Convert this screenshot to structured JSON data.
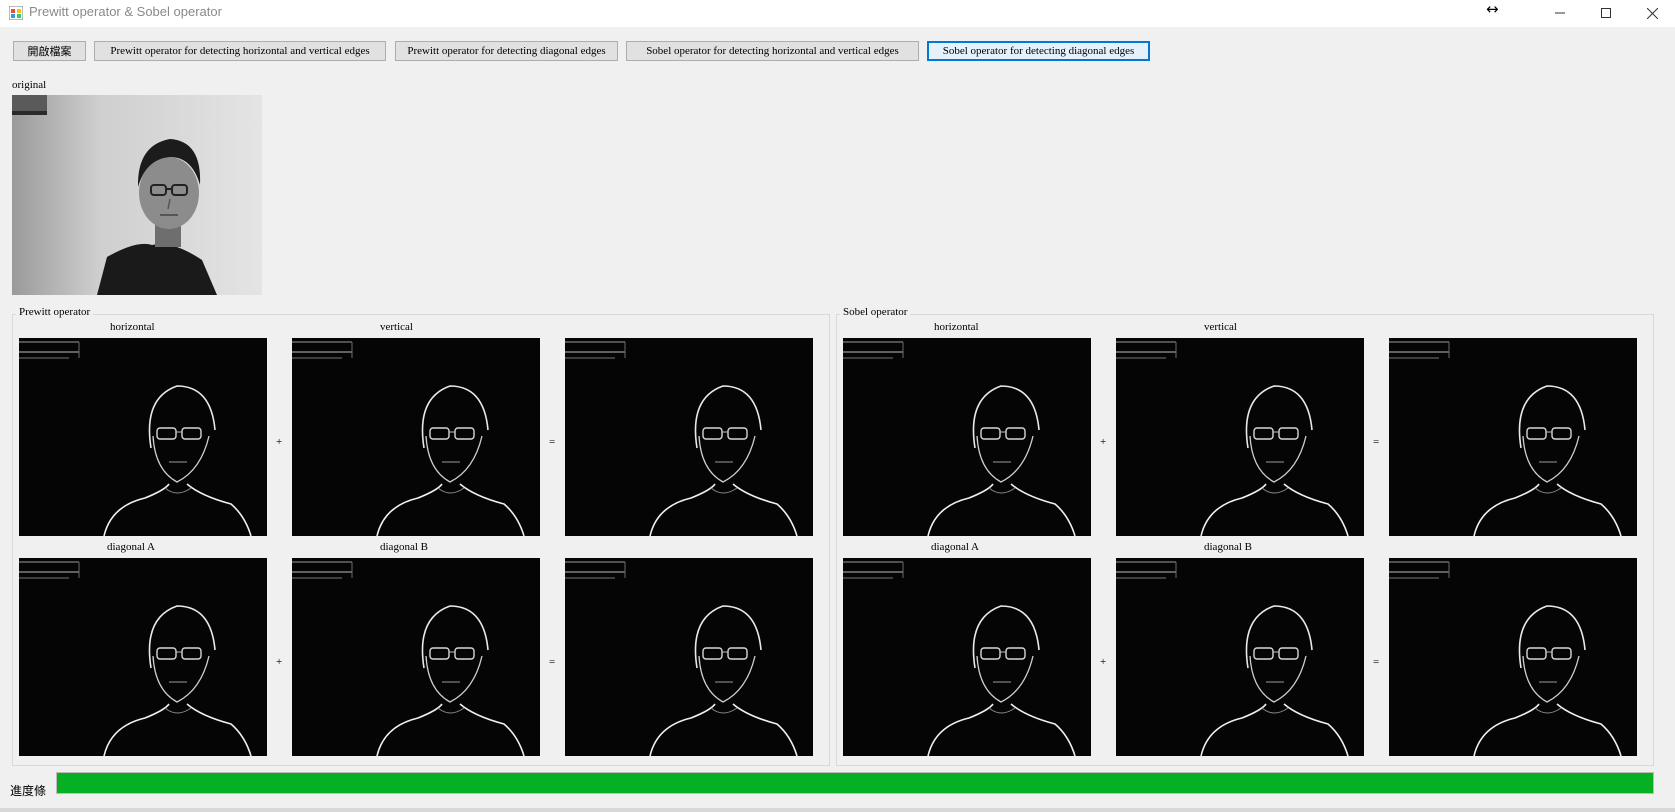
{
  "window": {
    "title": "Prewitt operator & Sobel operator"
  },
  "toolbar": {
    "open_file": "開啟檔案",
    "prewitt_hv": "Prewitt operator for detecting horizontal and vertical edges",
    "prewitt_diag": "Prewitt operator for detecting diagonal edges",
    "sobel_hv": "Sobel operator for detecting horizontal and vertical edges",
    "sobel_diag": "Sobel operator for detecting diagonal edges"
  },
  "original": {
    "label": "original"
  },
  "prewitt": {
    "title": "Prewitt operator",
    "horizontal": "horizontal",
    "vertical": "vertical",
    "diagonal_a": "diagonal A",
    "diagonal_b": "diagonal B"
  },
  "sobel": {
    "title": "Sobel operator",
    "horizontal": "horizontal",
    "vertical": "vertical",
    "diagonal_a": "diagonal A",
    "diagonal_b": "diagonal B"
  },
  "operators": {
    "plus": "+",
    "equals": "="
  },
  "progress": {
    "label": "進度條",
    "value": 1.0,
    "color": "#06b025"
  },
  "colors": {
    "accent": "#0078d7",
    "window_bg": "#f0f0f0"
  }
}
